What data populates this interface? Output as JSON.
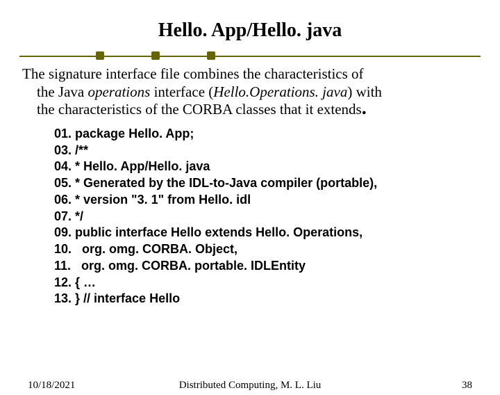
{
  "title": "Hello. App/Hello. java",
  "paragraph": {
    "p1": "The signature interface file combines the characteristics of",
    "p2a": "the Java ",
    "p2b": "operations",
    "p2c": " interface  (",
    "p2d": "Hello.Operations. java",
    "p2e": ") with",
    "p3a": "the characteristics of the CORBA classes that it extends",
    "p3dot": "."
  },
  "code": [
    "01. package Hello. App;",
    "03. /**",
    "04. * Hello. App/Hello. java",
    "05. * Generated by the IDL-to-Java compiler (portable),",
    "06. * version \"3. 1\" from Hello. idl",
    "07. */",
    "09. public interface Hello extends Hello. Operations,",
    "10.   org. omg. CORBA. Object,",
    "11.   org. omg. CORBA. portable. IDLEntity",
    "12. { …",
    "13. } // interface Hello"
  ],
  "footer": {
    "date": "10/18/2021",
    "center": "Distributed Computing, M. L. Liu",
    "page": "38"
  }
}
